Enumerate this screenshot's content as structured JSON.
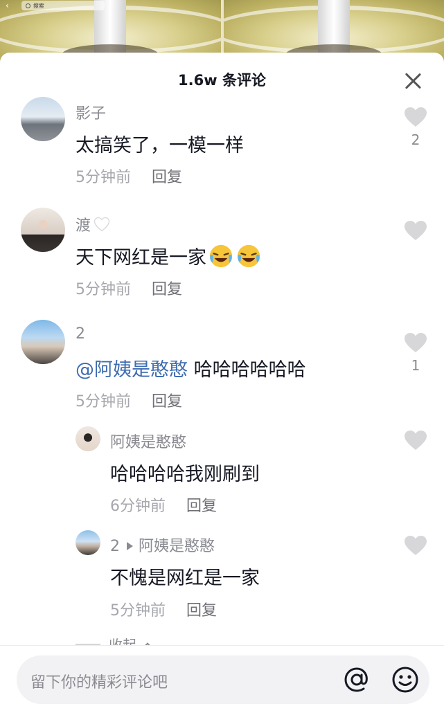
{
  "background": {
    "search_placeholder": "搜索"
  },
  "sheet": {
    "title": "1.6w 条评论"
  },
  "comments": [
    {
      "name": "影子",
      "text": "太搞笑了，一模一样",
      "time": "5分钟前",
      "reply_label": "回复",
      "like_count": "2"
    },
    {
      "name": "渡",
      "text": "天下网红是一家",
      "time": "5分钟前",
      "reply_label": "回复",
      "like_count": ""
    },
    {
      "name": "2",
      "mention": "@阿姨是憨憨",
      "text": "哈哈哈哈哈哈",
      "time": "5分钟前",
      "reply_label": "回复",
      "like_count": "1"
    }
  ],
  "replies": [
    {
      "name": "阿姨是憨憨",
      "text": "哈哈哈哈我刚刷到",
      "time": "6分钟前",
      "reply_label": "回复"
    },
    {
      "name": "2",
      "reply_to": "阿姨是憨憨",
      "text": "不愧是网红是一家",
      "time": "5分钟前",
      "reply_label": "回复"
    }
  ],
  "collapse_label": "收起",
  "input": {
    "placeholder": "留下你的精彩评论吧"
  },
  "colors": {
    "mention": "#3e6cb0",
    "heart": "#d7d7da",
    "text_primary": "#161823",
    "text_secondary": "#8a8b91"
  },
  "icons": [
    "close-icon",
    "heart-icon",
    "at-icon",
    "emoji-icon",
    "laughing-face-emoji",
    "white-heart-emoji",
    "search-icon",
    "back-icon"
  ]
}
